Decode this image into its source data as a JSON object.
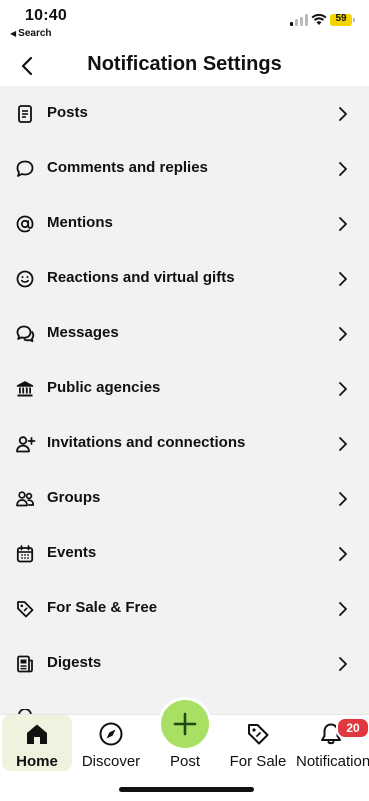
{
  "status_bar": {
    "time": "10:40",
    "back_app_label": "Search",
    "battery_level": "59",
    "battery_color": "#f5d500"
  },
  "header": {
    "title": "Notification Settings",
    "back_icon": "chevron-left-icon"
  },
  "settings_list": {
    "items": [
      {
        "label": "Posts",
        "icon": "document-icon"
      },
      {
        "label": "Comments and replies",
        "icon": "speech-bubble-icon"
      },
      {
        "label": "Mentions",
        "icon": "at-sign-icon"
      },
      {
        "label": "Reactions and virtual gifts",
        "icon": "smiley-icon"
      },
      {
        "label": "Messages",
        "icon": "chat-bubbles-icon"
      },
      {
        "label": "Public agencies",
        "icon": "government-building-icon"
      },
      {
        "label": "Invitations and connections",
        "icon": "person-add-icon"
      },
      {
        "label": "Groups",
        "icon": "group-icon"
      },
      {
        "label": "Events",
        "icon": "calendar-icon"
      },
      {
        "label": "For Sale & Free",
        "icon": "price-tag-icon"
      },
      {
        "label": "Digests",
        "icon": "newspaper-icon"
      }
    ]
  },
  "tab_bar": {
    "tabs": [
      {
        "label": "Home",
        "icon": "home-icon",
        "active": true
      },
      {
        "label": "Discover",
        "icon": "compass-icon"
      },
      {
        "label": "Post",
        "icon": "plus-icon"
      },
      {
        "label": "For Sale",
        "icon": "price-tag-icon"
      },
      {
        "label": "Notifications",
        "icon": "bell-icon",
        "badge": "20"
      }
    ],
    "accent_color": "#a8e063",
    "badge_color": "#e0383e"
  }
}
